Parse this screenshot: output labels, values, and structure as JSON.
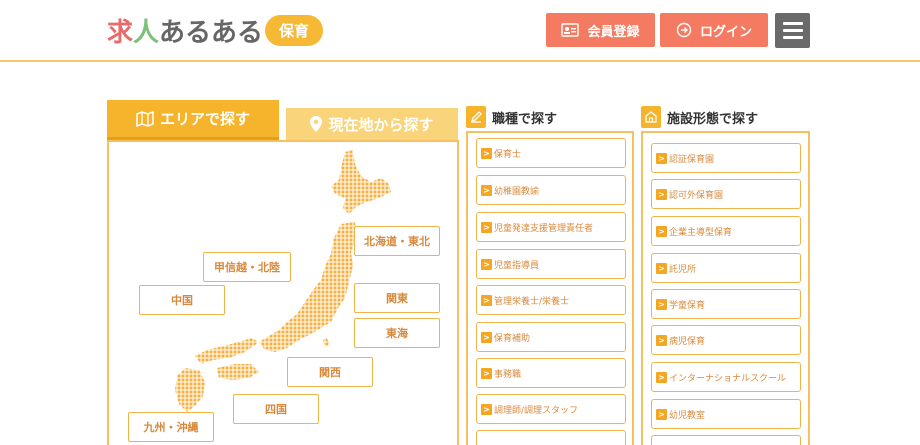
{
  "logo": {
    "part1": "求",
    "part2": "人",
    "part3": "あるある",
    "badge": "保育"
  },
  "header": {
    "register_label": "会員登録",
    "login_label": "ログイン"
  },
  "tabs": {
    "area_label": "エリアで探す",
    "gps_label": "現在地から探す"
  },
  "regions": [
    {
      "label": "北海道・東北"
    },
    {
      "label": "甲信越・北陸"
    },
    {
      "label": "中国"
    },
    {
      "label": "関東"
    },
    {
      "label": "東海"
    },
    {
      "label": "関西"
    },
    {
      "label": "四国"
    },
    {
      "label": "九州・沖縄"
    }
  ],
  "jobs": {
    "title": "職種で探す",
    "items": [
      {
        "label": "保育士"
      },
      {
        "label": "幼稚園教諭"
      },
      {
        "label": "児童発達支援管理責任者"
      },
      {
        "label": "児童指導員"
      },
      {
        "label": "管理栄養士/栄養士"
      },
      {
        "label": "保育補助"
      },
      {
        "label": "事務職"
      },
      {
        "label": "調理師/調理スタッフ"
      }
    ]
  },
  "facilities": {
    "title": "施設形態で探す",
    "items": [
      {
        "label": "認証保育園"
      },
      {
        "label": "認可外保育園"
      },
      {
        "label": "企業主導型保育"
      },
      {
        "label": "託児所"
      },
      {
        "label": "学童保育"
      },
      {
        "label": "病児保育"
      },
      {
        "label": "インターナショナルスクール"
      },
      {
        "label": "幼児教室"
      }
    ]
  },
  "colors": {
    "accent": "#f5b42c",
    "button": "#f47b61",
    "map_dot": "#f5b042",
    "menu": "#6a6a6a"
  }
}
